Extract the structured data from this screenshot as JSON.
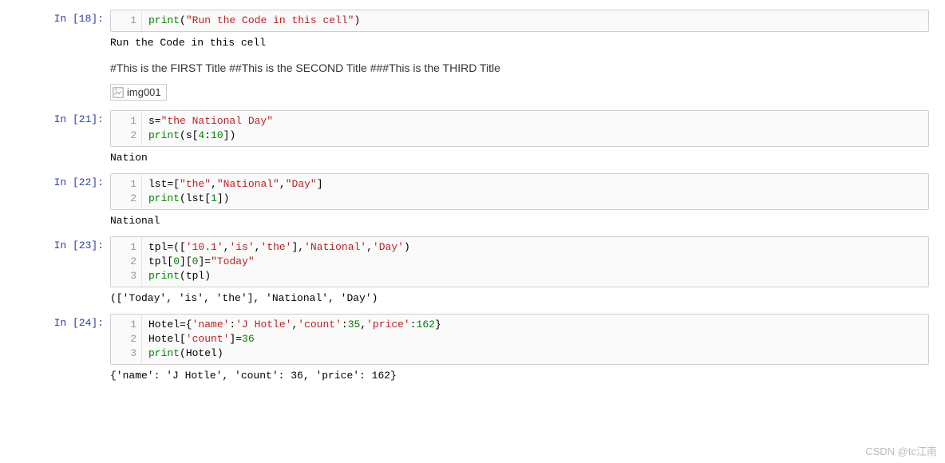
{
  "cells": {
    "c18": {
      "prompt": "In [18]:",
      "line_nos": [
        "1"
      ],
      "code_html": "<span class='k-func'>print</span>(<span class='k-str'>\"Run the Code in this cell\"</span>)",
      "output": "Run the Code in this cell"
    },
    "md_titles": "#This is the FIRST Title ##This is the SECOND Title ###This is the THIRD Title",
    "img_alt": "img001",
    "c21": {
      "prompt": "In [21]:",
      "line_nos": [
        "1",
        "2"
      ],
      "code_html": "s=<span class='k-str'>\"the National Day\"</span>\n<span class='k-func'>print</span>(s[<span class='k-num'>4</span>:<span class='k-num'>10</span>])",
      "output": "Nation"
    },
    "c22": {
      "prompt": "In [22]:",
      "line_nos": [
        "1",
        "2"
      ],
      "code_html": "lst=[<span class='k-str'>\"the\"</span>,<span class='k-str'>\"National\"</span>,<span class='k-str'>\"Day\"</span>]\n<span class='k-func'>print</span>(lst[<span class='k-num'>1</span>])",
      "output": "National"
    },
    "c23": {
      "prompt": "In [23]:",
      "line_nos": [
        "1",
        "2",
        "3"
      ],
      "code_html": "tpl=([<span class='k-str'>'10.1'</span>,<span class='k-str'>'is'</span>,<span class='k-str'>'the'</span>],<span class='k-str'>'National'</span>,<span class='k-str'>'Day'</span>)\ntpl[<span class='k-num'>0</span>][<span class='k-num'>0</span>]=<span class='k-str'>\"Today\"</span>\n<span class='k-func'>print</span>(tpl)",
      "output": "(['Today', 'is', 'the'], 'National', 'Day')"
    },
    "c24": {
      "prompt": "In [24]:",
      "line_nos": [
        "1",
        "2",
        "3"
      ],
      "code_html": "Hotel={<span class='k-str'>'name'</span>:<span class='k-str'>'J Hotle'</span>,<span class='k-str'>'count'</span>:<span class='k-num'>35</span>,<span class='k-str'>'price'</span>:<span class='k-num'>162</span>}\nHotel[<span class='k-str'>'count'</span>]=<span class='k-num'>36</span>\n<span class='k-func'>print</span>(Hotel)",
      "output": "{'name': 'J Hotle', 'count': 36, 'price': 162}"
    }
  },
  "watermark": "CSDN @tc江南"
}
